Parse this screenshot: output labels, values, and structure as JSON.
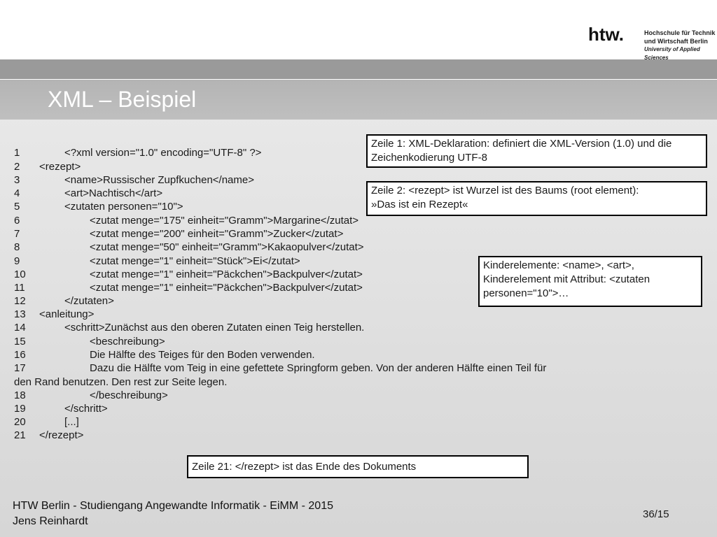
{
  "header": {
    "logo_mark": "htw.",
    "logo_line1": "Hochschule für Technik",
    "logo_line2": "und Wirtschaft Berlin",
    "logo_line3": "University of Applied Sciences"
  },
  "slide": {
    "title": "XML – Beispiel"
  },
  "code": {
    "lines": [
      {
        "n": "1",
        "text": "<?xml version=\"1.0\" encoding=\"UTF-8\" ?>"
      },
      {
        "n": "2",
        "text": "<rezept>"
      },
      {
        "n": "3",
        "text": "<name>Russischer Zupfkuchen</name>"
      },
      {
        "n": "4",
        "text": "<art>Nachtisch</art>"
      },
      {
        "n": "5",
        "text": "<zutaten personen=\"10\">"
      },
      {
        "n": "6",
        "text": "<zutat menge=\"175\" einheit=\"Gramm\">Margarine</zutat>"
      },
      {
        "n": "7",
        "text": "<zutat menge=\"200\" einheit=\"Gramm\">Zucker</zutat>"
      },
      {
        "n": "8",
        "text": "<zutat menge=\"50\" einheit=\"Gramm\">Kakaopulver</zutat>"
      },
      {
        "n": "9",
        "text": "<zutat menge=\"1\" einheit=\"Stück\">Ei</zutat>"
      },
      {
        "n": "10",
        "text": "<zutat menge=\"1\" einheit=\"Päckchen\">Backpulver</zutat>"
      },
      {
        "n": "11",
        "text": "<zutat menge=\"1\" einheit=\"Päckchen\">Backpulver</zutat>"
      },
      {
        "n": "12",
        "text": "</zutaten>"
      },
      {
        "n": "13",
        "text": "<anleitung>"
      },
      {
        "n": "14",
        "text": "<schritt>Zunächst aus den oberen Zutaten einen Teig herstellen."
      },
      {
        "n": "15",
        "text": "<beschreibung>"
      },
      {
        "n": "16",
        "text": "Die Hälfte des Teiges für den Boden verwenden."
      },
      {
        "n": "17",
        "text": "Dazu die Hälfte vom Teig in eine gefettete Springform geben. Von der anderen Hälfte einen Teil für"
      },
      {
        "n": "",
        "text": "den Rand benutzen. Den rest zur Seite legen."
      },
      {
        "n": "18",
        "text": "</beschreibung>"
      },
      {
        "n": "19",
        "text": "</schritt>"
      },
      {
        "n": "20",
        "text": "[...]"
      },
      {
        "n": "21",
        "text": "</rezept>"
      }
    ]
  },
  "notes": {
    "n1": "Zeile 1: XML-Deklaration:  definiert die XML-Version (1.0) und die Zeichenkodierung UTF-8",
    "n2_line1": "Zeile 2: <rezept> ist  Wurzel ist des Baums (root element):",
    "n2_line2": "»Das ist ein Rezept«",
    "n3_line1": "Kinderelemente: <name>, <art>,",
    "n3_line2": "Kinderelement mit Attribut: <zutaten",
    "n3_line3": "personen=\"10\">…",
    "n4": "Zeile 21: </rezept> ist das Ende des Dokuments"
  },
  "footer": {
    "line1": "HTW Berlin - Studiengang Angewandte Informatik - EiMM - 2015",
    "line2": "Jens Reinhardt",
    "page": "36/15"
  }
}
